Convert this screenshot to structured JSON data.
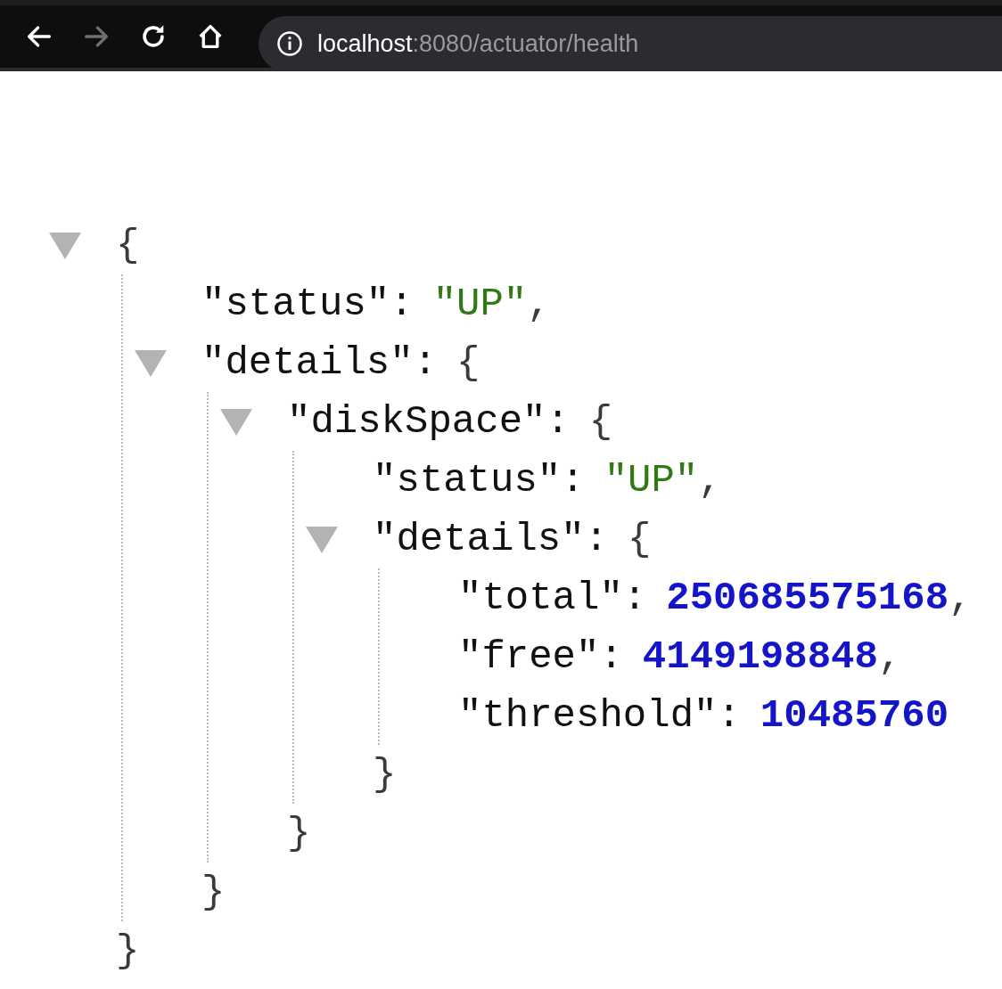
{
  "toolbar": {
    "buttons": [
      {
        "kind": "back",
        "disabled": false
      },
      {
        "kind": "forward",
        "disabled": true
      },
      {
        "kind": "reload",
        "disabled": false
      },
      {
        "kind": "home",
        "disabled": false
      }
    ],
    "url": {
      "host": "localhost",
      "path": ":8080/actuator/health"
    }
  },
  "tree": {
    "kind": "object",
    "open": "{",
    "close": "}",
    "expanded": true,
    "children": [
      {
        "kind": "string",
        "key": "\"status\":",
        "value": "\"UP\"",
        "comma": ","
      },
      {
        "kind": "object",
        "key": "\"details\":",
        "open": "{",
        "close": "}",
        "expanded": true,
        "children": [
          {
            "kind": "object",
            "key": "\"diskSpace\":",
            "open": "{",
            "close": "}",
            "expanded": true,
            "children": [
              {
                "kind": "string",
                "key": "\"status\":",
                "value": "\"UP\"",
                "comma": ","
              },
              {
                "kind": "object",
                "key": "\"details\":",
                "open": "{",
                "close": "}",
                "expanded": true,
                "children": [
                  {
                    "kind": "number",
                    "key": "\"total\":",
                    "value": "250685575168",
                    "comma": ","
                  },
                  {
                    "kind": "number",
                    "key": "\"free\":",
                    "value": "4149198848",
                    "comma": ","
                  },
                  {
                    "kind": "number",
                    "key": "\"threshold\":",
                    "value": "10485760"
                  }
                ]
              }
            ]
          }
        ]
      }
    ]
  }
}
